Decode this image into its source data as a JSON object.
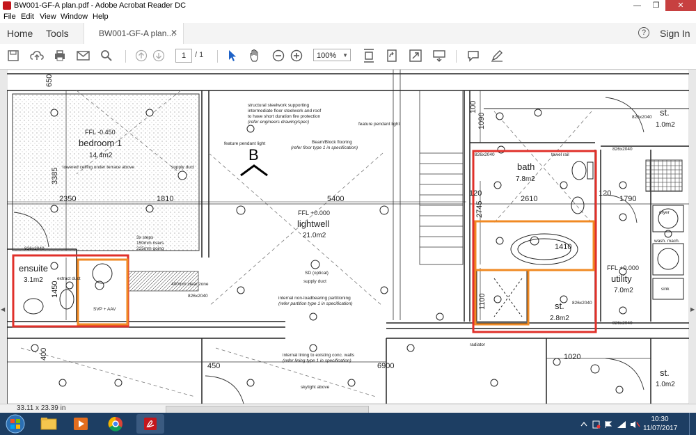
{
  "window": {
    "title": "BW001-GF-A plan.pdf - Adobe Acrobat Reader DC",
    "minimize": "—",
    "maximize": "❐",
    "close": "✕"
  },
  "menu": [
    "File",
    "Edit",
    "View",
    "Window",
    "Help"
  ],
  "nav": {
    "home": "Home",
    "tools": "Tools",
    "tab_label": "BW001-GF-A plan....",
    "tab_close": "✕",
    "help": "?",
    "signin": "Sign In"
  },
  "toolbar": {
    "page_current": "1",
    "page_total": "/ 1",
    "zoom": "100%"
  },
  "plan": {
    "rooms": [
      {
        "name": "bedroom 1",
        "area": "14.4m2"
      },
      {
        "name": "lightwell",
        "area": "21.0m2"
      },
      {
        "name": "ensuite",
        "area": "3.1m2"
      },
      {
        "name": "bath",
        "area": "7.8m2"
      },
      {
        "name": "utility",
        "area": "7.0m2"
      },
      {
        "name": "st.",
        "area": "2.8m2"
      },
      {
        "name": "st.",
        "area": "1.0m2"
      },
      {
        "name": "st.",
        "area": "1.0m2"
      }
    ],
    "dims": [
      "650",
      "3385",
      "2350",
      "1810",
      "5400",
      "1450",
      "400",
      "450",
      "6900",
      "1020",
      "100",
      "1090",
      "120",
      "2610",
      "120",
      "1790",
      "2745",
      "1410",
      "1100"
    ],
    "levels": [
      "FFL -0.450",
      "FFL +0.000",
      "FFL +0.000"
    ],
    "notes": {
      "steel": "structural steelwork supporting",
      "steel2": "intermediate floor steelwork and roof",
      "steel3": "to have short duration fire protection",
      "steel4": "(refer engineers drawing/spec)",
      "beam": "Beam/Block flooring",
      "beam2": "(refer floor type 1 in specification)",
      "pendant1": "feature pendant light",
      "pendant2": "feature pendant light",
      "lowered": "lowered ceiling under terrace above",
      "supply1": "supply duct",
      "steps": "3x steps",
      "steps2": "150mm risers",
      "steps3": "225mm going",
      "partition": "internal non-loadbearing partitioning",
      "partition2": "(refer partition type 1 in specification)",
      "lining": "internal lining to existing conc. walls",
      "lining2": "(refer lining type 1 in specification)",
      "sd": "SD (optical)",
      "supply2": "supply duct",
      "svp": "SVP + AAV",
      "clear": "400mm clear zone",
      "extract": "extract duct",
      "towel": "towel rail",
      "dryer": "dryer",
      "wash": "wash. mach.",
      "sink": "sink",
      "skylight": "skylight above",
      "section": "B",
      "door1": "826x2040",
      "door2": "826x2040",
      "door3": "826x2040",
      "door4": "826x2040",
      "door5": "826x2040",
      "door6": "826x2040",
      "door7": "826x2040",
      "radiator": "radiator"
    }
  },
  "status": {
    "doc_size": "33.11 x 23.39 in"
  },
  "taskbar": {
    "time": "10:30",
    "date": "11/07/2017"
  },
  "colors": {
    "red_box": "#e0302a",
    "orange_box": "#f08a24",
    "taskbar": "#1d3e63",
    "accent": "#c4161c"
  }
}
